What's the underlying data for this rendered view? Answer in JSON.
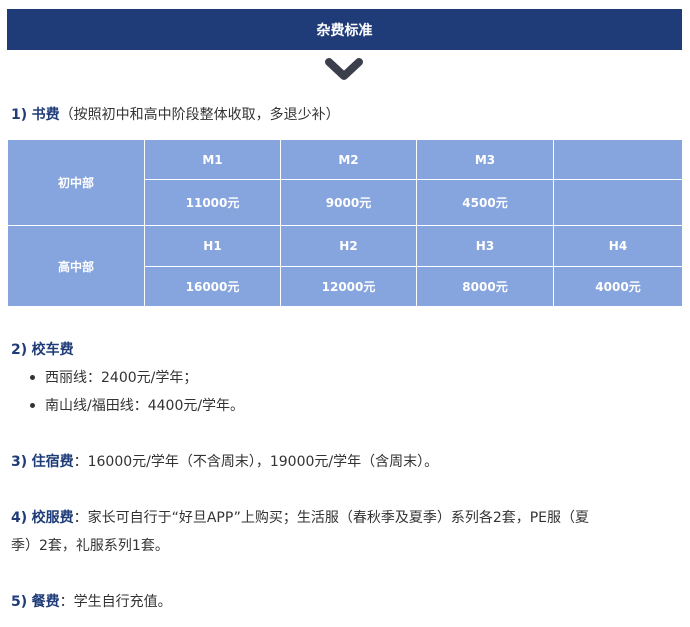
{
  "banner": {
    "title": "杂费标准"
  },
  "icons": {
    "banner_chevron": "chevron-down-icon"
  },
  "colors": {
    "banner_bg": "#1f3c78",
    "table_bg": "#86a4dd",
    "heading": "#1f3c78"
  },
  "books": {
    "num": "1)",
    "name": "书费",
    "note": "（按照初中和高中阶段整体收取，多退少补）",
    "middle": {
      "label": "初中部",
      "levels": [
        "M1",
        "M2",
        "M3",
        ""
      ],
      "amounts": [
        "11000元",
        "9000元",
        "4500元",
        ""
      ]
    },
    "high": {
      "label": "高中部",
      "levels": [
        "H1",
        "H2",
        "H3",
        "H4"
      ],
      "amounts": [
        "16000元",
        "12000元",
        "8000元",
        "4000元"
      ]
    }
  },
  "bus": {
    "num": "2)",
    "name": "校车费",
    "items": [
      "西丽线：2400元/学年；",
      "南山线/福田线：4400元/学年。"
    ]
  },
  "boarding": {
    "num": "3)",
    "name": "住宿费",
    "text": "：16000元/学年（不含周末），19000元/学年（含周末）。"
  },
  "uniform": {
    "num": "4)",
    "name": "校服费",
    "line1": "：家长可自行于“好旦APP”上购买；生活服（春秋季及夏季）系列各2套，PE服（夏",
    "line2": "季）2套，礼服系列1套。"
  },
  "meal": {
    "num": "5)",
    "name": "餐费",
    "text": "：学生自行充值。"
  }
}
